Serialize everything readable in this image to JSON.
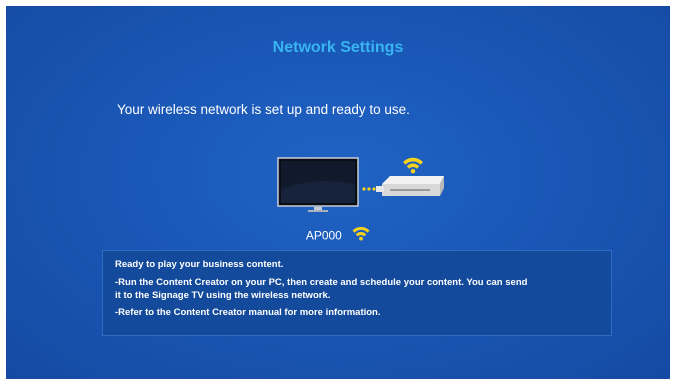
{
  "dialog": {
    "title": "Network Settings",
    "message": "Your wireless network is set up and ready to use."
  },
  "connection": {
    "ap_name": "AP000",
    "icons": [
      "tv-icon",
      "router-icon",
      "wifi-signal-icon"
    ]
  },
  "info": {
    "line1": "Ready to play your business content.",
    "line2a": "-Run the Content Creator on your PC, then create and schedule your content. You can send",
    "line2b": "it to the Signage TV using the wireless network.",
    "line3": "-Refer to the Content Creator manual for more information."
  },
  "colors": {
    "background": "#1a57b6",
    "title": "#38b4f2",
    "wifi": "#f6d21c",
    "info_box": "#134a9c"
  }
}
